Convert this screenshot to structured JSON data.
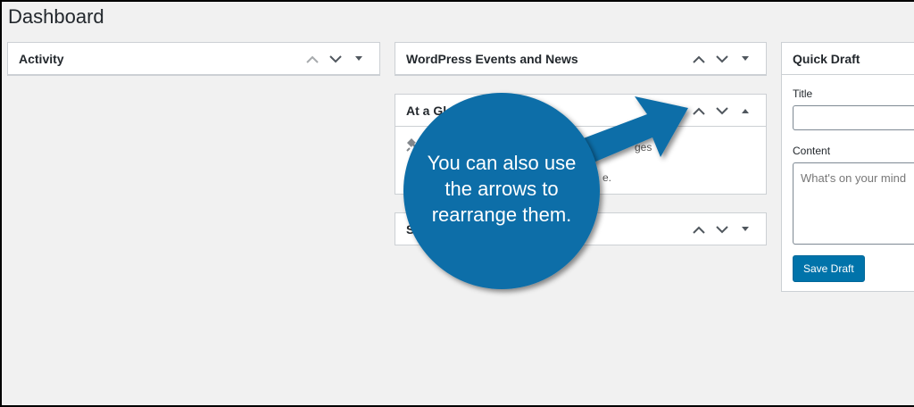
{
  "page": {
    "title": "Dashboard"
  },
  "widgets": {
    "activity": {
      "title": "Activity"
    },
    "events": {
      "title": "WordPress Events and News"
    },
    "glance": {
      "title": "At a Gla",
      "right_text_1": "ges",
      "right_text_2": "e."
    },
    "site_health": {
      "title": "Si"
    },
    "quick_draft": {
      "title": "Quick Draft",
      "title_label": "Title",
      "content_label": "Content",
      "content_placeholder": "What's on your mind",
      "save_label": "Save Draft"
    }
  },
  "callout": {
    "line1": "You can also use",
    "line2": "the arrows to",
    "line3": "rearrange them.",
    "color": "#0d6ea8"
  },
  "icons": [
    "chevron-up-icon",
    "chevron-down-icon",
    "caret-down-icon",
    "caret-up-icon",
    "pushpin-icon"
  ]
}
